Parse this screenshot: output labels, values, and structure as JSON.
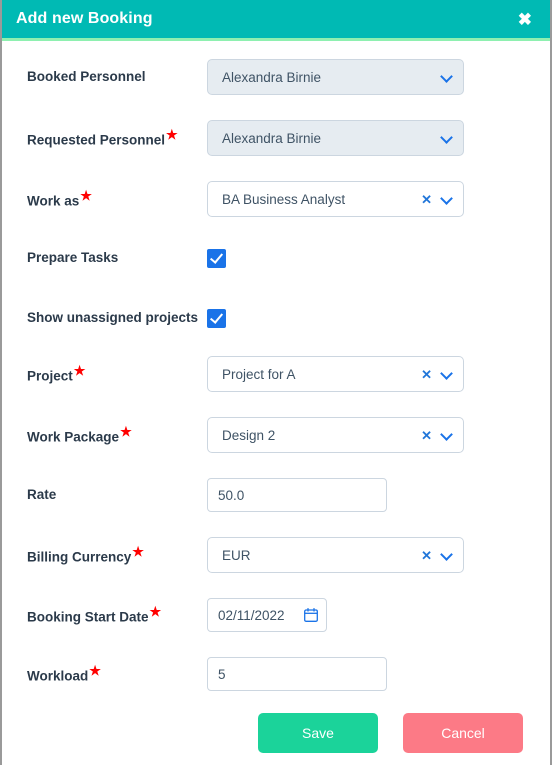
{
  "header": {
    "title": "Add new Booking",
    "close_label": "✖"
  },
  "colors": {
    "header_teal": "#00bab4",
    "header_underline": "#8ef0b0",
    "checkbox_blue": "#1a73e8",
    "save_green": "#1bd39a",
    "cancel_red": "#fc7a86",
    "required_star": "#ff0000",
    "disabled_field_bg": "#e6ecf1",
    "field_border": "#ccd6e0",
    "label_text": "#2b3a4a",
    "value_text": "#3f5365"
  },
  "form": {
    "fields": [
      {
        "name": "booked-personnel",
        "label": "Booked Personnel",
        "required": false,
        "type": "select",
        "value": "Alexandra Birnie",
        "disabled": true,
        "clearable": false
      },
      {
        "name": "requested-personnel",
        "label": "Requested Personnel",
        "required": true,
        "type": "select",
        "value": "Alexandra Birnie",
        "disabled": true,
        "clearable": false
      },
      {
        "name": "work-as",
        "label": "Work as",
        "required": true,
        "type": "select",
        "value": "BA Business Analyst",
        "disabled": false,
        "clearable": true
      },
      {
        "name": "prepare-tasks",
        "label": "Prepare Tasks",
        "required": false,
        "type": "checkbox",
        "checked": true
      },
      {
        "name": "show-unassigned-projects",
        "label": "Show unassigned projects",
        "required": false,
        "type": "checkbox",
        "checked": true
      },
      {
        "name": "project",
        "label": "Project",
        "required": true,
        "type": "select",
        "value": "Project for A",
        "disabled": false,
        "clearable": true
      },
      {
        "name": "work-package",
        "label": "Work Package",
        "required": true,
        "type": "select",
        "value": "Design 2",
        "disabled": false,
        "clearable": true
      },
      {
        "name": "rate",
        "label": "Rate",
        "required": false,
        "type": "text",
        "value": "50.0",
        "placeholder": ""
      },
      {
        "name": "billing-currency",
        "label": "Billing Currency",
        "required": true,
        "type": "select",
        "value": "EUR",
        "disabled": false,
        "clearable": true
      },
      {
        "name": "booking-start-date",
        "label": "Booking Start Date",
        "required": true,
        "type": "date",
        "value": "02/11/2022",
        "icon": "calendar-icon"
      },
      {
        "name": "workload",
        "label": "Workload",
        "required": true,
        "type": "text",
        "value": "5",
        "placeholder": ""
      }
    ],
    "required_marker": "★",
    "clear_marker": "✕"
  },
  "footer": {
    "save_label": "Save",
    "cancel_label": "Cancel"
  }
}
